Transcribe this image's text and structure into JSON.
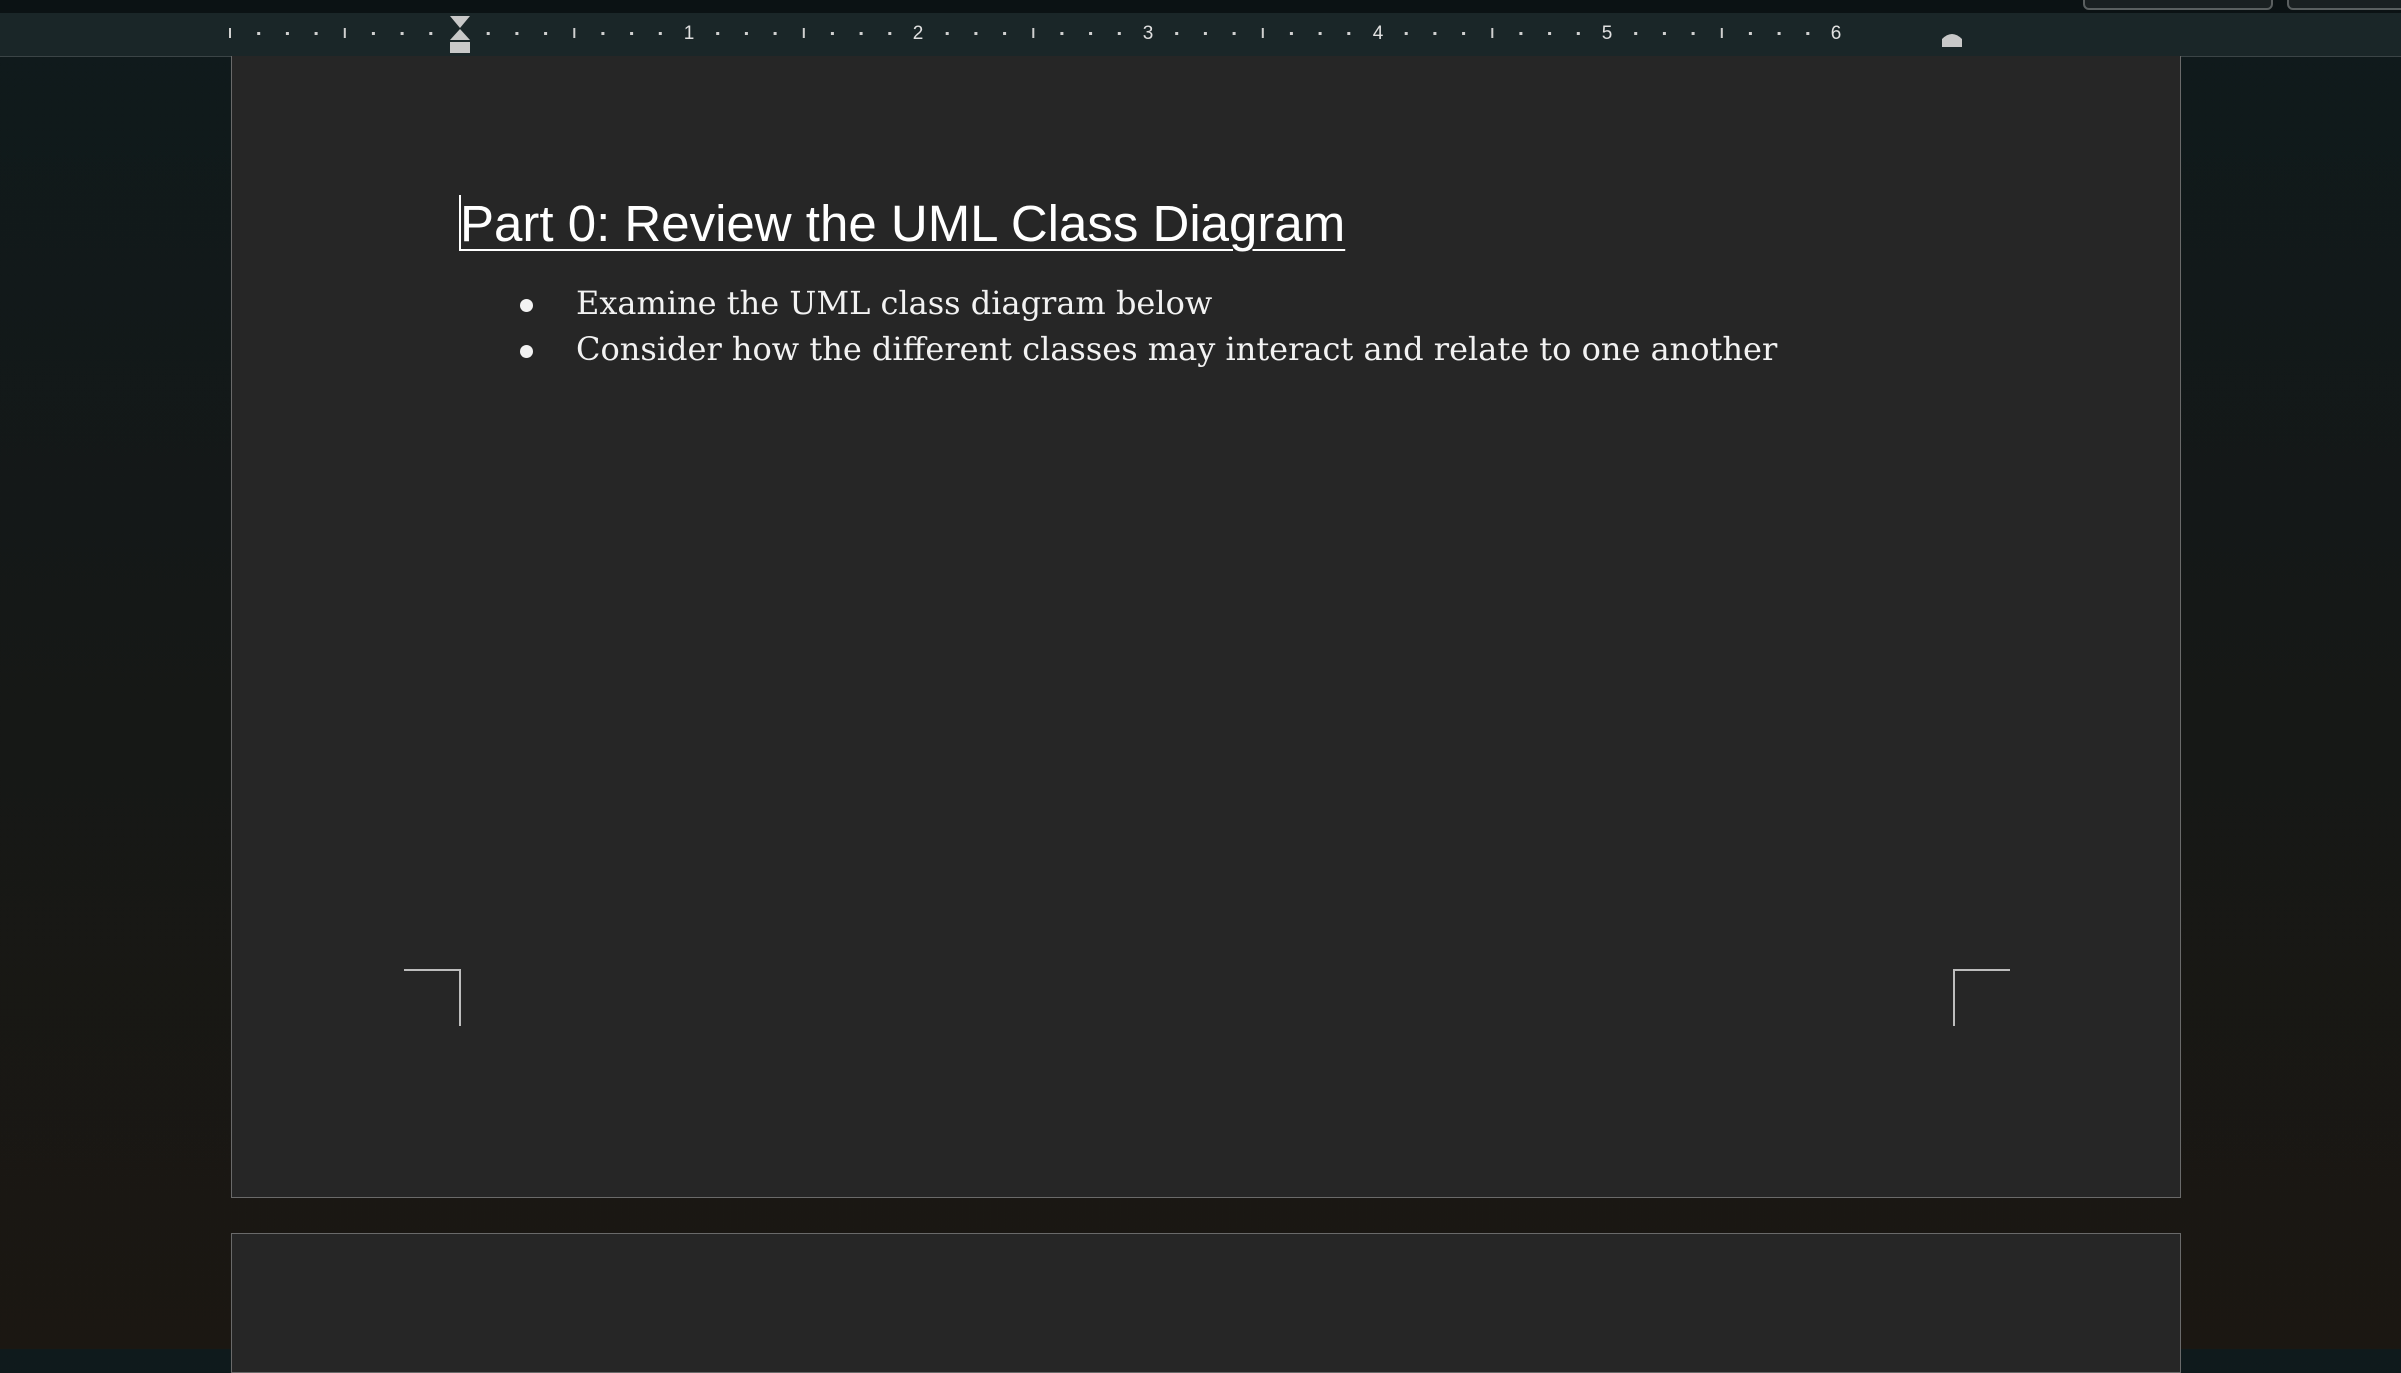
{
  "ruler": {
    "labels": [
      "1",
      "2",
      "3",
      "4",
      "5",
      "6"
    ]
  },
  "document": {
    "heading": "Part 0: Review the UML Class Diagram",
    "bullets": [
      "Examine the UML class diagram below",
      "Consider how the different classes may interact and relate to one another"
    ]
  },
  "colors": {
    "page_background": "#262626",
    "canvas_background": "#151817",
    "text": "#ffffff"
  }
}
